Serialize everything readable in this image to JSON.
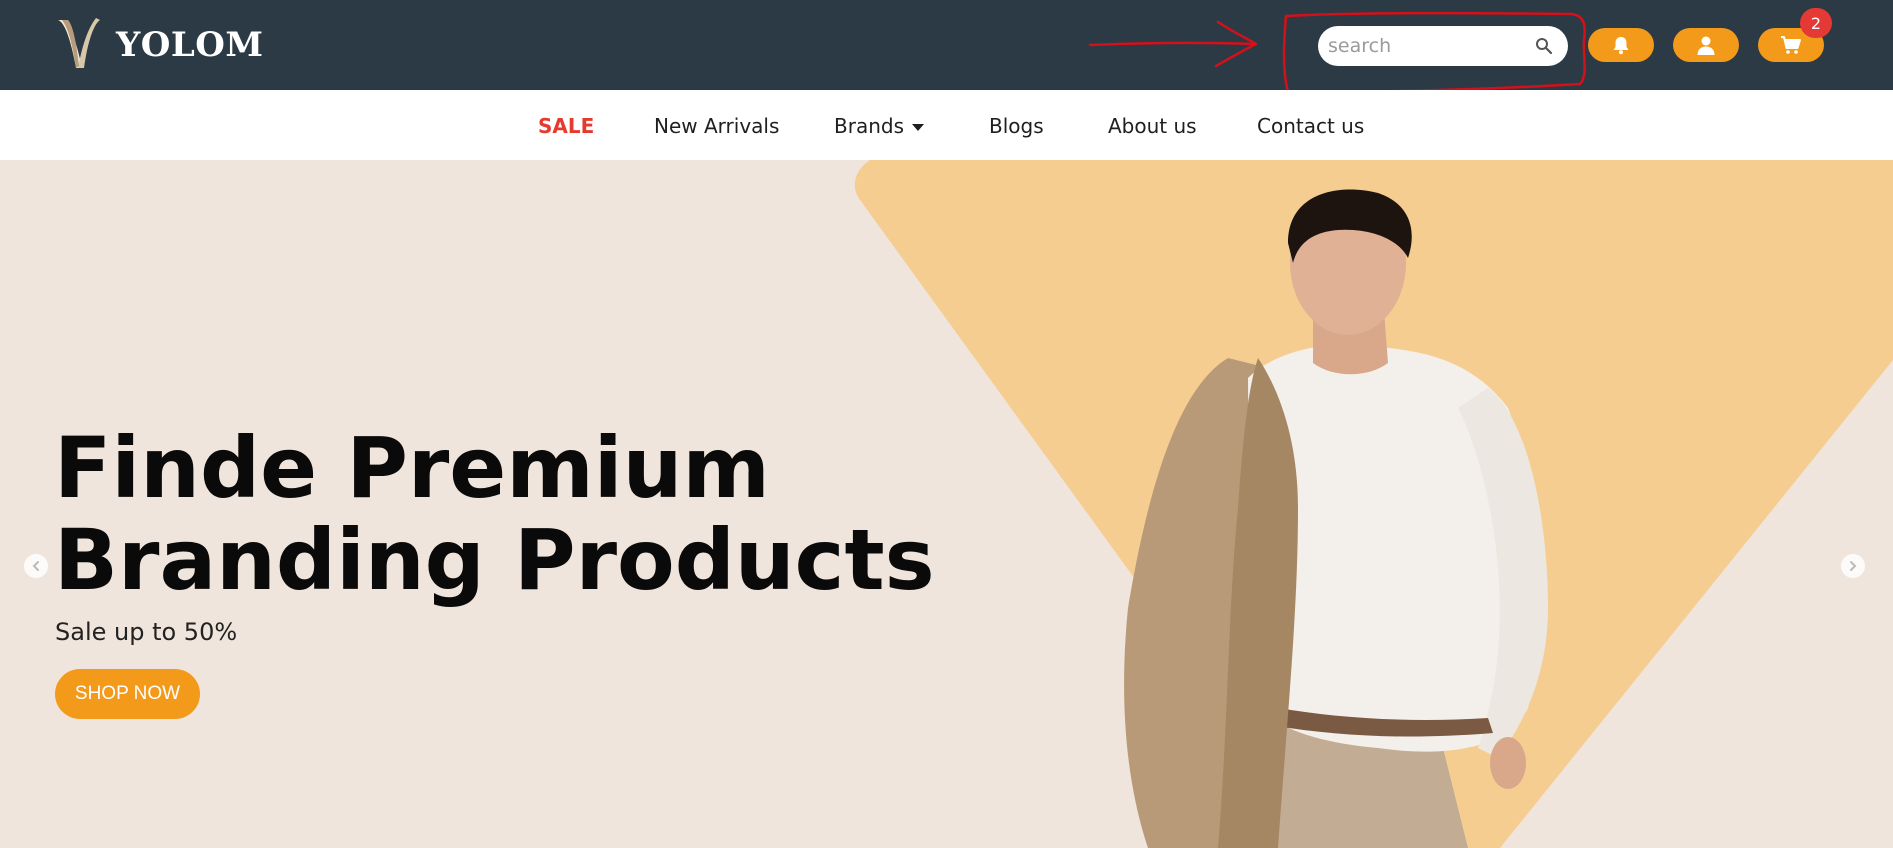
{
  "brand": {
    "name": "YOLOM",
    "logo_icon": "yolom-logo"
  },
  "header": {
    "search": {
      "placeholder": "search",
      "value": "",
      "icon": "search-icon"
    },
    "buttons": [
      {
        "name": "notifications",
        "icon": "bell-icon"
      },
      {
        "name": "account",
        "icon": "user-icon"
      },
      {
        "name": "cart",
        "icon": "cart-icon"
      }
    ],
    "cart_count": "2",
    "annotation": {
      "type": "hand-drawn arrow and box around search",
      "color": "#d4101a"
    }
  },
  "nav": {
    "items": [
      {
        "label": "SALE",
        "highlight": true
      },
      {
        "label": "New Arrivals"
      },
      {
        "label": "Brands",
        "has_dropdown": true
      },
      {
        "label": "Blogs"
      },
      {
        "label": "About us"
      },
      {
        "label": "Contact us"
      }
    ]
  },
  "hero": {
    "title_line1": "Finde Premium",
    "title_line2": "Branding Products",
    "subtitle": "Sale up to 50%",
    "cta_label": "SHOP NOW",
    "prev_icon": "chevron-left-icon",
    "next_icon": "chevron-right-icon"
  },
  "colors": {
    "topbar": "#2b3a45",
    "accent": "#f39a1b",
    "sale": "#e63a2e",
    "hero_bg": "#efe5dc",
    "hero_shape": "#f6cd91",
    "badge": "#e53935"
  }
}
